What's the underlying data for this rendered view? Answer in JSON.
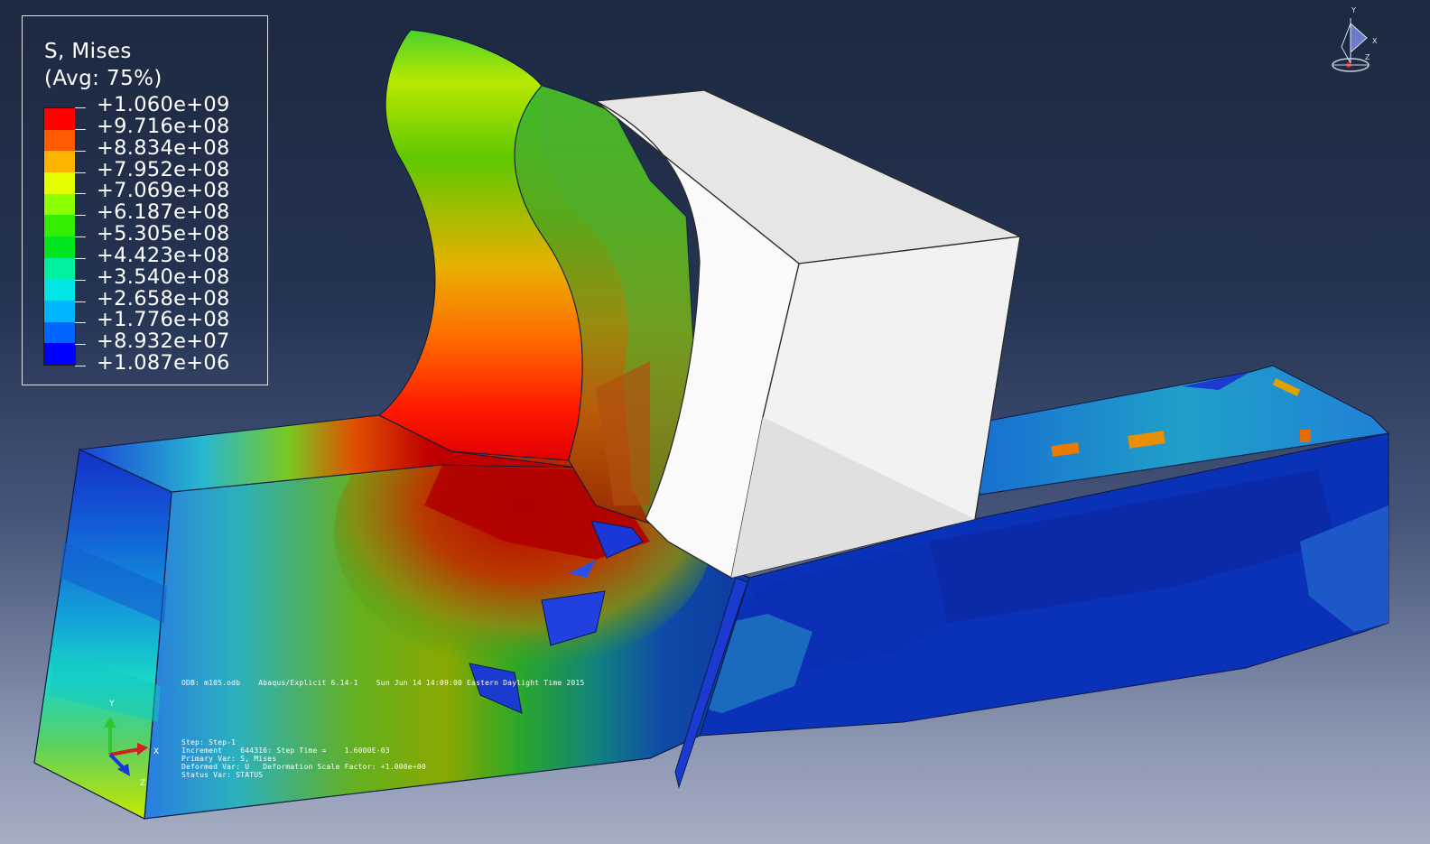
{
  "legend": {
    "title_line1": "S, Mises",
    "title_line2": "(Avg: 75%)",
    "labels": [
      "+1.060e+09",
      "+9.716e+08",
      "+8.834e+08",
      "+7.952e+08",
      "+7.069e+08",
      "+6.187e+08",
      "+5.305e+08",
      "+4.423e+08",
      "+3.540e+08",
      "+2.658e+08",
      "+1.776e+08",
      "+8.932e+07",
      "+1.087e+06"
    ],
    "colors": [
      "#ff0000",
      "#ff5a00",
      "#ffb400",
      "#e6ff00",
      "#8cff00",
      "#33ee00",
      "#00e61e",
      "#00f0a0",
      "#00e6e6",
      "#00b4ff",
      "#0064ff",
      "#0000ff"
    ]
  },
  "viewport_info": {
    "odb_line": "ODB: m105.odb    Abaqus/Explicit 6.14-1    Sun Jun 14 14:09:00 Eastern Daylight Time 2015"
  },
  "status": {
    "step": "Step: Step-1",
    "increment": "Increment    644316: Step Time =    1.6000E-03",
    "primary_var": "Primary Var: S, Mises",
    "deformed_var": "Deformed Var: U   Deformation Scale Factor: +1.000e+00",
    "status_var": "Status Var: STATUS"
  },
  "triad": {
    "x": "X",
    "y": "Y",
    "z": "Z"
  },
  "view_cube": {
    "x": "X",
    "y": "Y",
    "z": "Z"
  }
}
